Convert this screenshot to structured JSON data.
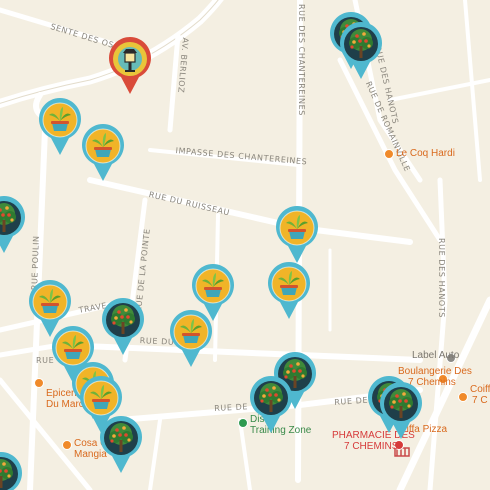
{
  "streets": {
    "sente_des_oseraies": "SENTE DES OSERAIES",
    "av_berlioz": "AV. BERLIOZ",
    "rue_des_chantereines": "RUE DES CHANTEREINES",
    "rue_des_hanots_top": "RUE DES HANOTS",
    "rue_de_romainville": "RUE DE ROMAINVILLE",
    "impasse_des_chantereines": "IMPASSE DES CHANTEREINES",
    "rue_du_ruisseau": "RUE DU RUISSEAU",
    "rue_poulin": "RUE POULIN",
    "rue_de_la_pointe": "RUE DE LA POINTE",
    "rue_des_hanots_right": "RUE DES HANOTS",
    "traverse_fragment": "TRAVE",
    "rue_du_ch_fragment": "RUE DU CH",
    "rue_fragment": "RUE",
    "rue_de_fragment": "RUE DE",
    "rue_des_bottom": "RUE DES"
  },
  "pois": {
    "coq_hardi": "Le Coq Hardi",
    "label_auto": "Label Auto",
    "boulangerie_line1": "Boulangerie Des",
    "boulangerie_line2": "7 Chemins",
    "coiffeur_line1": "Coiff",
    "coiffeur_line2": "7 C",
    "epicerie_line1": "Epicerie",
    "epicerie_line2": "Du Marc",
    "cosa_line1": "Cosa C",
    "cosa_line2": "Mangia",
    "training_line1": "Dis",
    "training_line2": "Training Zone",
    "pharmacie_line1": "PHARMACIE DES",
    "pharmacie_line2": "7 CHEMINS",
    "pizza": "Piffa Pizza"
  },
  "marker_types": {
    "planter": "potted-plant-icon",
    "tree": "fruit-tree-icon",
    "lamp": "street-lamp-icon"
  },
  "colors": {
    "background": "#f4efe2",
    "road": "#ffffff",
    "marker_ring": "#4fb8cf",
    "planter_bg": "#f0b428",
    "tree_bg": "#1f3f4a",
    "lamp_bg": "#e9c53a"
  }
}
